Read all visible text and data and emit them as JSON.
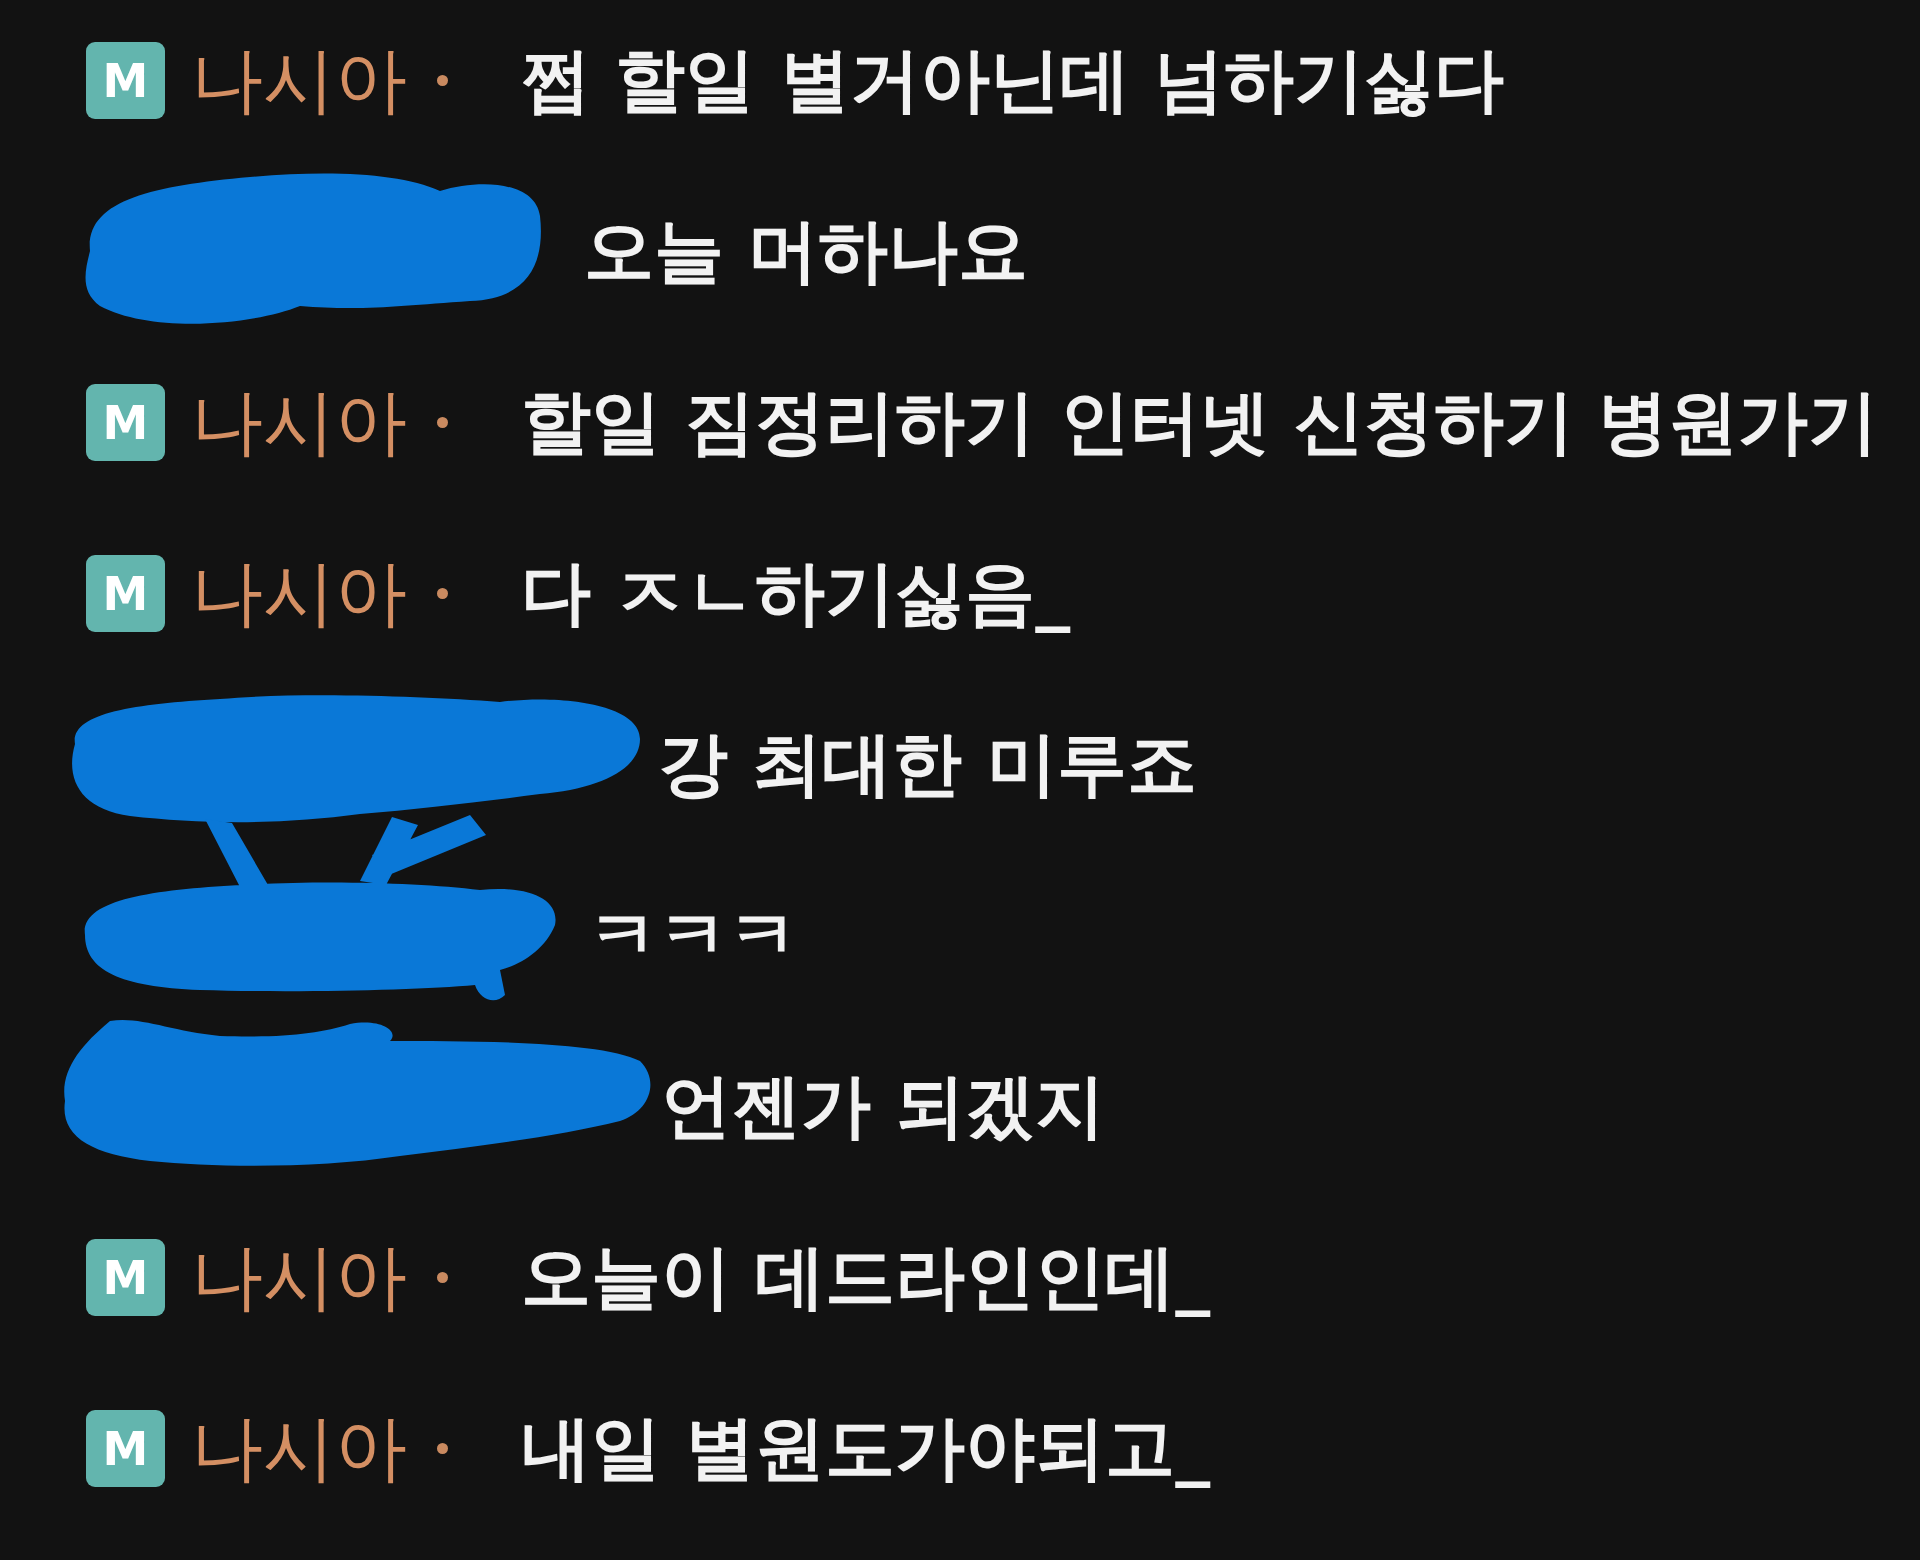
{
  "messages": [
    {
      "kind": "member",
      "badge": "M",
      "name": "나시아",
      "text": "쩝 할일 별거아닌데 넘하기싫다"
    },
    {
      "kind": "redacted",
      "text": "오늘 머하나요"
    },
    {
      "kind": "member",
      "badge": "M",
      "name": "나시아",
      "text": "할일 짐정리하기 인터넷 신청하기 병원가기"
    },
    {
      "kind": "member",
      "badge": "M",
      "name": "나시아",
      "text": "다 ㅈㄴ하기싫음_"
    },
    {
      "kind": "redacted",
      "text": "강 최대한 미루죠"
    },
    {
      "kind": "redacted",
      "text": "ㅋㅋㅋ"
    },
    {
      "kind": "redacted",
      "text": "언젠가 되겠지"
    },
    {
      "kind": "member",
      "badge": "M",
      "name": "나시아",
      "text": "오늘이 데드라인인데_"
    },
    {
      "kind": "member",
      "badge": "M",
      "name": "나시아",
      "text": "내일 별원도가야되고_"
    }
  ]
}
